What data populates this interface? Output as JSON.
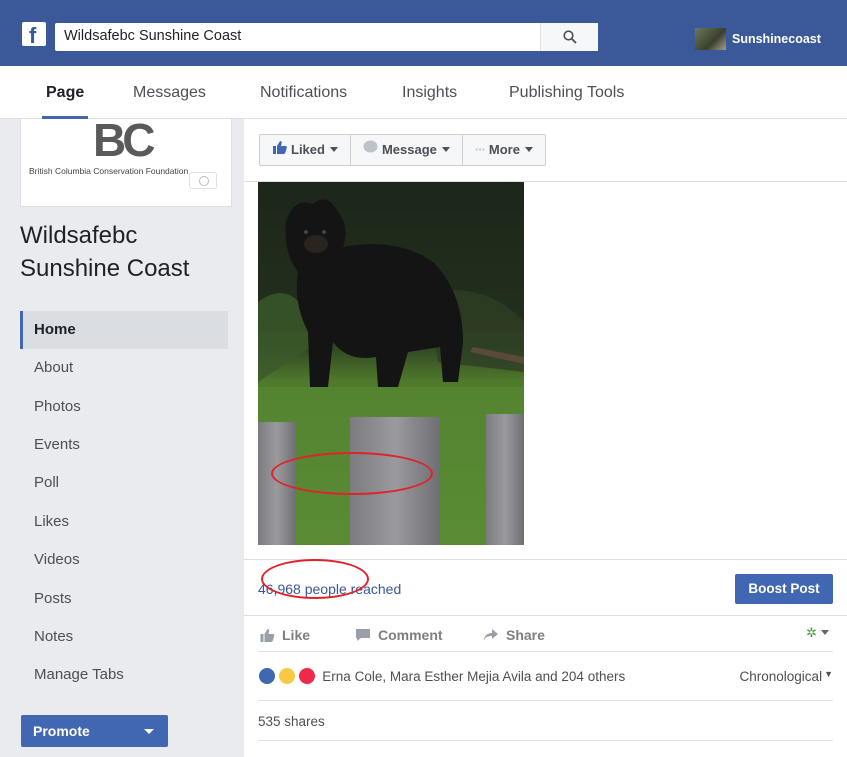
{
  "header": {
    "search_value": "Wildsafebc Sunshine Coast",
    "user_name": "Sunshinecoast",
    "brand_color": "#3b5998"
  },
  "tabs": [
    {
      "label": "Page",
      "active": true
    },
    {
      "label": "Messages"
    },
    {
      "label": "Notifications"
    },
    {
      "label": "Insights"
    },
    {
      "label": "Publishing Tools"
    }
  ],
  "sidebar": {
    "logo_text": "BC",
    "logo_caption": "British Columbia Conservation Foundation",
    "page_name": "Wildsafebc Sunshine Coast",
    "items": [
      "Home",
      "About",
      "Photos",
      "Events",
      "Poll",
      "Likes",
      "Videos",
      "Posts",
      "Notes",
      "Manage Tabs"
    ],
    "active_item": "Home",
    "promote_label": "Promote"
  },
  "post": {
    "liked_label": "Liked",
    "message_label": "Message",
    "more_label": "More",
    "reach_text": "46,968 people reached",
    "boost_label": "Boost Post",
    "like_label": "Like",
    "comment_label": "Comment",
    "share_label": "Share",
    "reactions_text": "Erna Cole, Mara Esther Mejia Avila and 204 others",
    "sort_label": "Chronological",
    "shares_text": "535 shares"
  }
}
